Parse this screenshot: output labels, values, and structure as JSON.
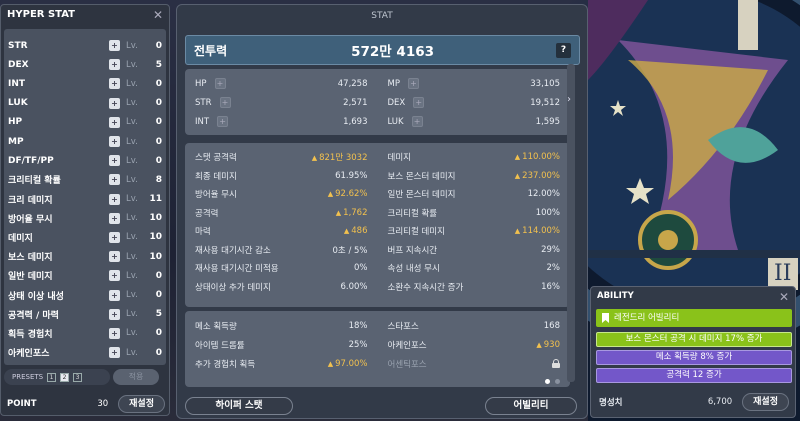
{
  "hyper_stat": {
    "title": "HYPER STAT",
    "close": "✕",
    "lv_label": "Lv.",
    "plus": "+",
    "items": [
      {
        "name": "STR",
        "level": "0"
      },
      {
        "name": "DEX",
        "level": "5"
      },
      {
        "name": "INT",
        "level": "0"
      },
      {
        "name": "LUK",
        "level": "0"
      },
      {
        "name": "HP",
        "level": "0"
      },
      {
        "name": "MP",
        "level": "0"
      },
      {
        "name": "DF/TF/PP",
        "level": "0"
      },
      {
        "name": "크리티컬 확률",
        "level": "8"
      },
      {
        "name": "크리 데미지",
        "level": "11"
      },
      {
        "name": "방어율 무시",
        "level": "10"
      },
      {
        "name": "데미지",
        "level": "10"
      },
      {
        "name": "보스 데미지",
        "level": "10"
      },
      {
        "name": "일반 데미지",
        "level": "0"
      },
      {
        "name": "상태 이상 내성",
        "level": "0"
      },
      {
        "name": "공격력 / 마력",
        "level": "5"
      },
      {
        "name": "획득 경험치",
        "level": "0"
      },
      {
        "name": "아케인포스",
        "level": "0"
      }
    ],
    "presets_label": "PRESETS",
    "presets": [
      "1",
      "2",
      "3"
    ],
    "apply_label": "적용",
    "point_label": "POINT",
    "point_value": "30",
    "reset_label": "재설정"
  },
  "stat": {
    "title": "STAT",
    "combat_power_label": "전투력",
    "combat_power_value": "572만 4163",
    "help": "?",
    "basic": [
      {
        "name": "HP",
        "value": "47,258"
      },
      {
        "name": "MP",
        "value": "33,105"
      },
      {
        "name": "STR",
        "value": "2,571"
      },
      {
        "name": "DEX",
        "value": "19,512"
      },
      {
        "name": "INT",
        "value": "1,693"
      },
      {
        "name": "LUK",
        "value": "1,595"
      }
    ],
    "detail": [
      {
        "name": "스탯 공격력",
        "value": "821만 3032",
        "up": true
      },
      {
        "name": "데미지",
        "value": "110.00%",
        "up": true
      },
      {
        "name": "최종 데미지",
        "value": "61.95%",
        "up": false
      },
      {
        "name": "보스 몬스터 데미지",
        "value": "237.00%",
        "up": true
      },
      {
        "name": "방어율 무시",
        "value": "92.62%",
        "up": true
      },
      {
        "name": "일반 몬스터 데미지",
        "value": "12.00%",
        "up": false
      },
      {
        "name": "공격력",
        "value": "1,762",
        "up": true
      },
      {
        "name": "크리티컬 확률",
        "value": "100%",
        "up": false
      },
      {
        "name": "마력",
        "value": "486",
        "up": true
      },
      {
        "name": "크리티컬 데미지",
        "value": "114.00%",
        "up": true
      },
      {
        "name": "재사용 대기시간 감소",
        "value": "0초 / 5%",
        "up": false
      },
      {
        "name": "버프 지속시간",
        "value": "29%",
        "up": false
      },
      {
        "name": "재사용 대기시간 미적용",
        "value": "0%",
        "up": false
      },
      {
        "name": "속성 내성 무시",
        "value": "2%",
        "up": false
      },
      {
        "name": "상태이상 추가 데미지",
        "value": "6.00%",
        "up": false
      },
      {
        "name": "소환수 지속시간 증가",
        "value": "16%",
        "up": false
      }
    ],
    "extra": [
      {
        "name": "메소 획득량",
        "value": "18%",
        "up": false
      },
      {
        "name": "스타포스",
        "value": "168",
        "up": false
      },
      {
        "name": "아이템 드롭률",
        "value": "25%",
        "up": false
      },
      {
        "name": "아케인포스",
        "value": "930",
        "up": true
      },
      {
        "name": "추가 경험치 획득",
        "value": "97.00%",
        "up": true
      },
      {
        "name": "어센틱포스",
        "value": "",
        "locked": true
      }
    ],
    "up_arrow": "▲",
    "side_arrow": "›",
    "hyper_button": "하이퍼 스탯",
    "ability_button": "어빌리티"
  },
  "ability": {
    "title": "ABILITY",
    "close": "✕",
    "grade": "레전드리 어빌리티",
    "lines": [
      "보스 몬스터 공격 시 데미지 17% 증가",
      "메소 획득량 8% 증가",
      "공격력 12 증가"
    ],
    "honor_label": "명성치",
    "honor_value": "6,700",
    "reset_label": "재설정"
  },
  "colors": {
    "gold": "#f2c14e",
    "legendary": "#8ac21a",
    "unique_line": "#7357c9"
  }
}
